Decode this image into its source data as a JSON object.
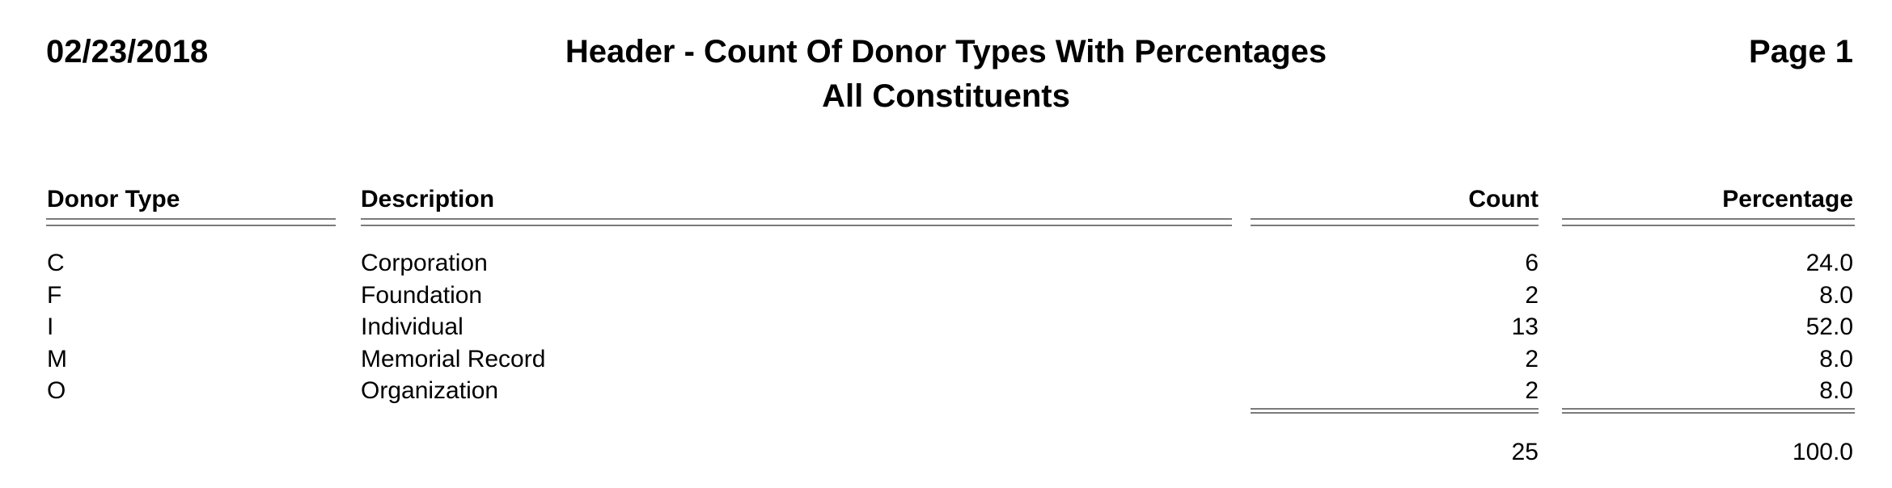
{
  "report": {
    "date": "02/23/2018",
    "title": "Header - Count Of Donor Types With Percentages",
    "subtitle": "All Constituents",
    "page_label": "Page 1"
  },
  "table": {
    "columns": [
      "Donor Type",
      "Description",
      "Count",
      "Percentage"
    ],
    "rows": [
      {
        "type": "C",
        "description": "Corporation",
        "count": "6",
        "percentage": "24.0"
      },
      {
        "type": "F",
        "description": "Foundation",
        "count": "2",
        "percentage": "8.0"
      },
      {
        "type": "I",
        "description": "Individual",
        "count": "13",
        "percentage": "52.0"
      },
      {
        "type": "M",
        "description": "Memorial Record",
        "count": "2",
        "percentage": "8.0"
      },
      {
        "type": "O",
        "description": "Organization",
        "count": "2",
        "percentage": "8.0"
      }
    ],
    "totals": {
      "count": "25",
      "percentage": "100.0"
    }
  },
  "colors": {
    "text": "#000000",
    "rule": "#7a7a7a",
    "background": "#ffffff"
  }
}
